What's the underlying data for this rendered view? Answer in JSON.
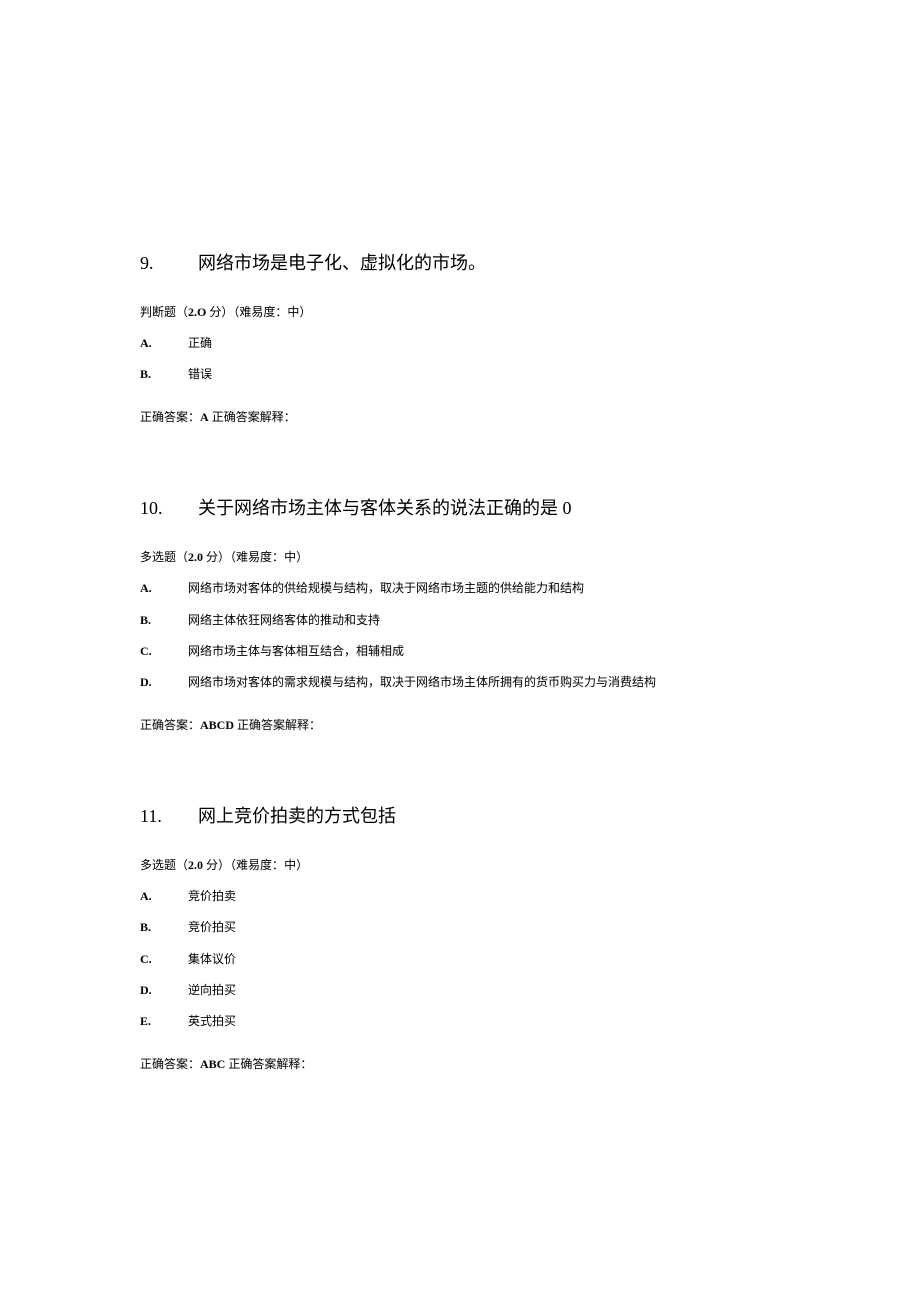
{
  "questions": [
    {
      "number": "9.",
      "title": "网络市场是电子化、虚拟化的市场。",
      "type_label": "判断题",
      "score_open": "（",
      "score": "2.O",
      "score_unit": " 分）",
      "diff_open": "（难易度：",
      "difficulty": "中",
      "diff_close": "）",
      "options": [
        {
          "letter": "A.",
          "text": "正确"
        },
        {
          "letter": "B.",
          "text": "错误"
        }
      ],
      "answer_prefix": "正确答案：",
      "answer": "A",
      "answer_suffix": " 正确答案解释："
    },
    {
      "number": "10.",
      "title": "关于网络市场主体与客体关系的说法正确的是 0",
      "type_label": "多选题",
      "score_open": "（",
      "score": "2.0",
      "score_unit": " 分）",
      "diff_open": "（难易度：",
      "difficulty": "中",
      "diff_close": "）",
      "options": [
        {
          "letter": "A.",
          "text": "网络市场对客体的供给规模与结构，取决于网络市场主题的供给能力和结构"
        },
        {
          "letter": "B.",
          "text": "网络主体依狂网络客体的推动和支持"
        },
        {
          "letter": "C.",
          "text": "网络市场主体与客体相互结合，相辅相成"
        },
        {
          "letter": "D.",
          "text": "网络市场对客体的需求规模与结构，取决于网络市场主体所拥有的货币购买力与消费结构"
        }
      ],
      "answer_prefix": "正确答案：",
      "answer": "ABCD",
      "answer_suffix": " 正确答案解释："
    },
    {
      "number": "11.",
      "title": "网上竞价拍卖的方式包括",
      "type_label": "多选题",
      "score_open": "（",
      "score": "2.0",
      "score_unit": " 分）",
      "diff_open": "（难易度：",
      "difficulty": "中",
      "diff_close": "）",
      "options": [
        {
          "letter": "A.",
          "text": "竞价拍卖"
        },
        {
          "letter": "B.",
          "text": "竞价拍买"
        },
        {
          "letter": "C.",
          "text": "集体议价"
        },
        {
          "letter": "D.",
          "text": "逆向拍买"
        },
        {
          "letter": "E.",
          "text": "英式拍买"
        }
      ],
      "answer_prefix": "正确答案：",
      "answer": "ABC",
      "answer_suffix": " 正确答案解释："
    }
  ]
}
